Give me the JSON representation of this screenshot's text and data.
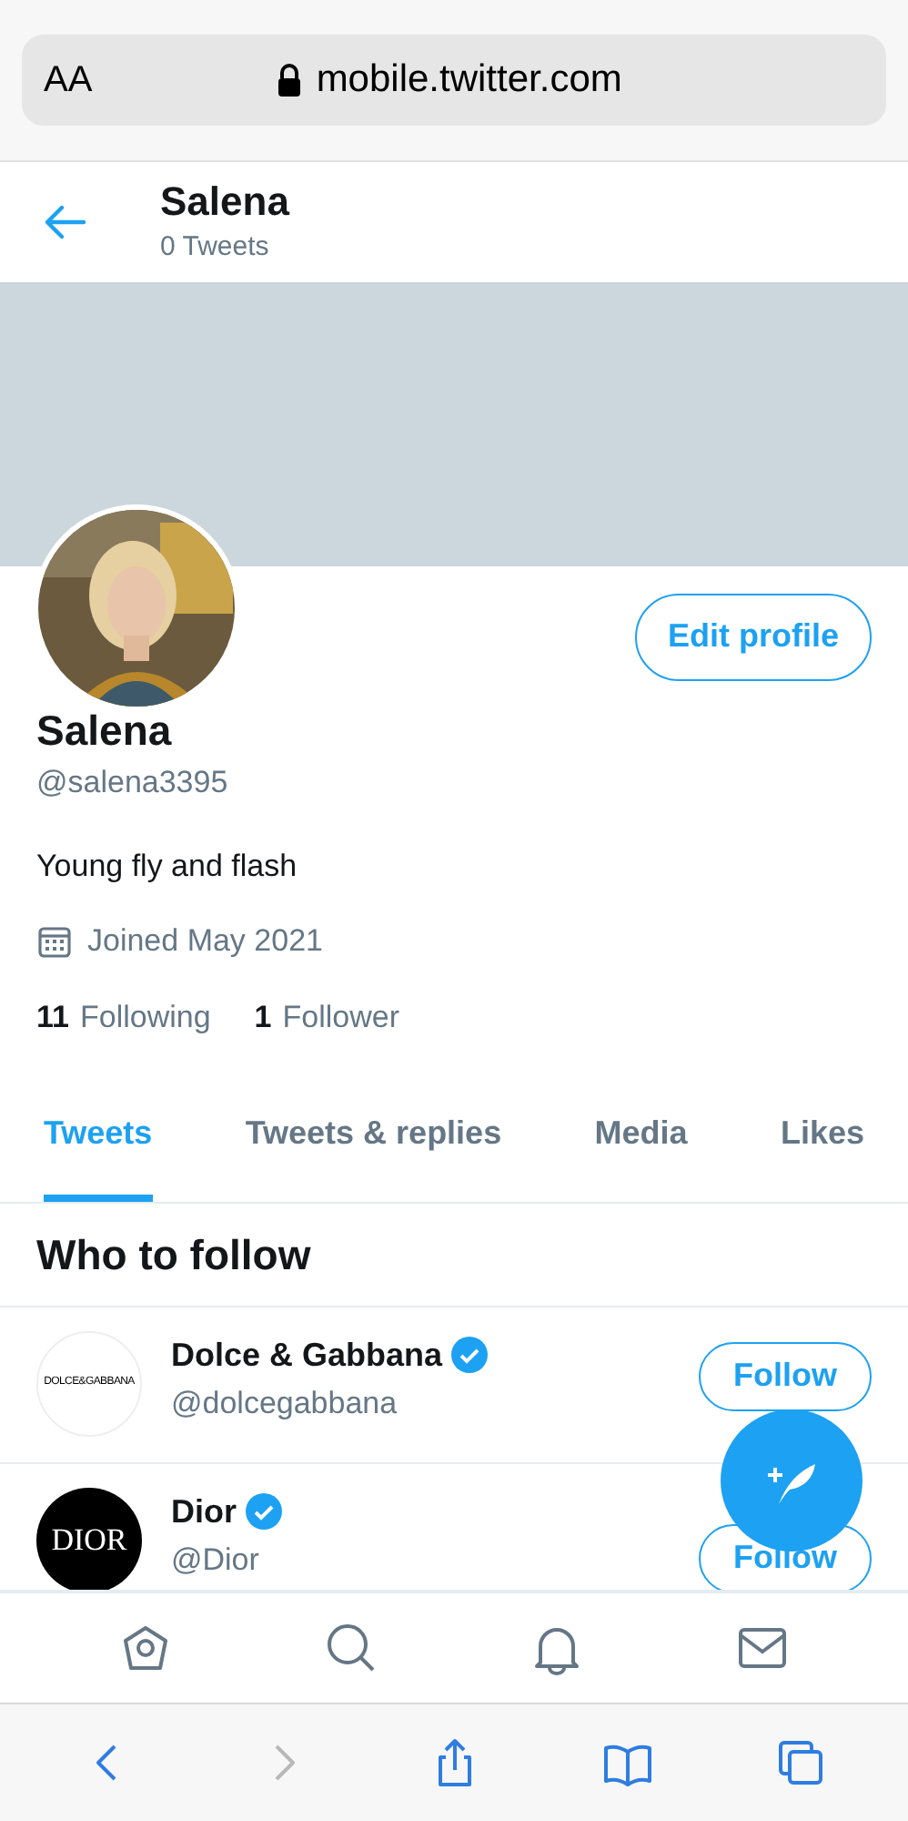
{
  "browser": {
    "text_size": "AA",
    "url": "mobile.twitter.com"
  },
  "header": {
    "title": "Salena",
    "subtitle": "0 Tweets"
  },
  "profile": {
    "edit_button": "Edit profile",
    "name": "Salena",
    "handle": "@salena3395",
    "bio": "Young fly and flash",
    "joined": "Joined May 2021",
    "stats": [
      {
        "count": "11",
        "label": "Following"
      },
      {
        "count": "1",
        "label": "Follower"
      }
    ]
  },
  "tabs": [
    {
      "label": "Tweets",
      "selected": true
    },
    {
      "label": "Tweets & replies",
      "selected": false
    },
    {
      "label": "Media",
      "selected": false
    },
    {
      "label": "Likes",
      "selected": false
    }
  ],
  "who_to_follow": {
    "title": "Who to follow",
    "accounts": [
      {
        "name": "Dolce & Gabbana",
        "handle": "@dolcegabbana",
        "verified": true,
        "logo": "DOLCE&GABBANA",
        "kind": "light",
        "button": "Follow"
      },
      {
        "name": "Dior",
        "handle": "@Dior",
        "verified": true,
        "logo": "DIOR",
        "kind": "dark",
        "button": "Follow"
      }
    ]
  },
  "browser_toolbar": [
    {
      "kind": "back",
      "disabled": false
    },
    {
      "kind": "forward",
      "disabled": true
    },
    {
      "kind": "share",
      "disabled": false
    },
    {
      "kind": "bookmarks",
      "disabled": false
    },
    {
      "kind": "tabs",
      "disabled": false
    }
  ]
}
